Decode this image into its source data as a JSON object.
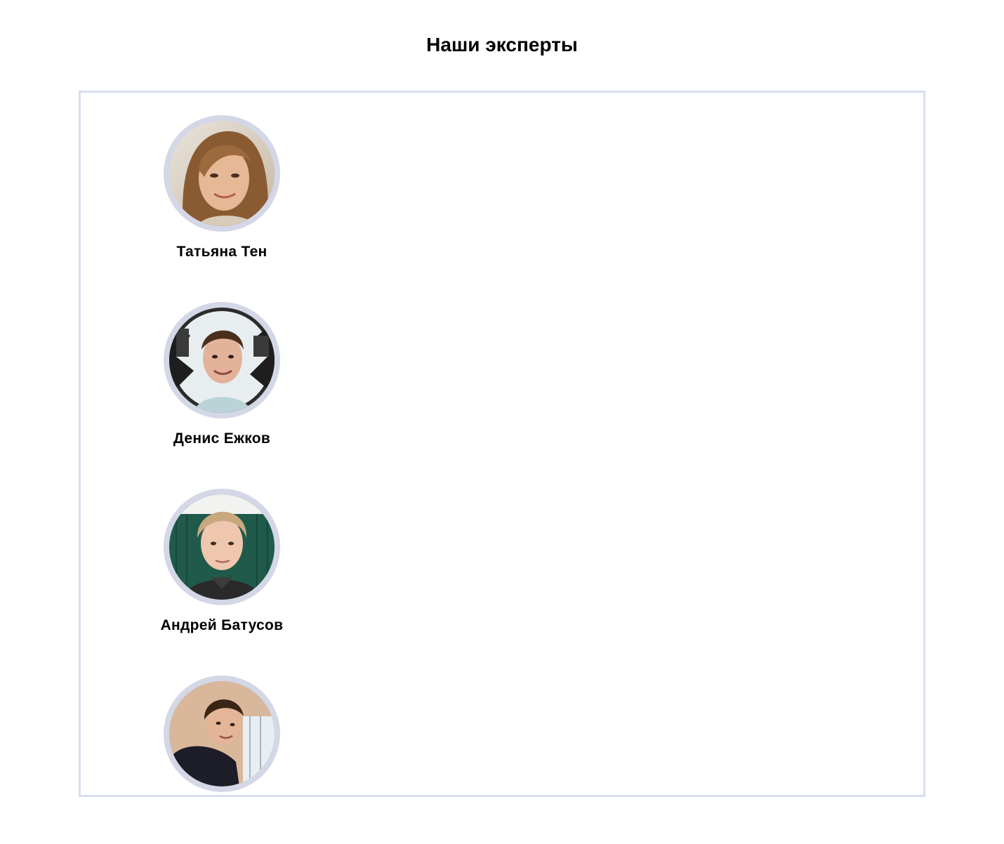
{
  "header": {
    "title": "Наши эксперты"
  },
  "experts": [
    {
      "name": "Татьяна Тен",
      "avatar": "female-portrait-photo"
    },
    {
      "name": "Денис Ежков",
      "avatar": "male-portrait-photo"
    },
    {
      "name": "Андрей Батусов",
      "avatar": "male-portrait-photo"
    },
    {
      "name": "",
      "avatar": "male-portrait-photo"
    }
  ],
  "colors": {
    "box_border": "#d9ddf3",
    "avatar_ring": "#d3d7e6",
    "text": "#000000"
  }
}
